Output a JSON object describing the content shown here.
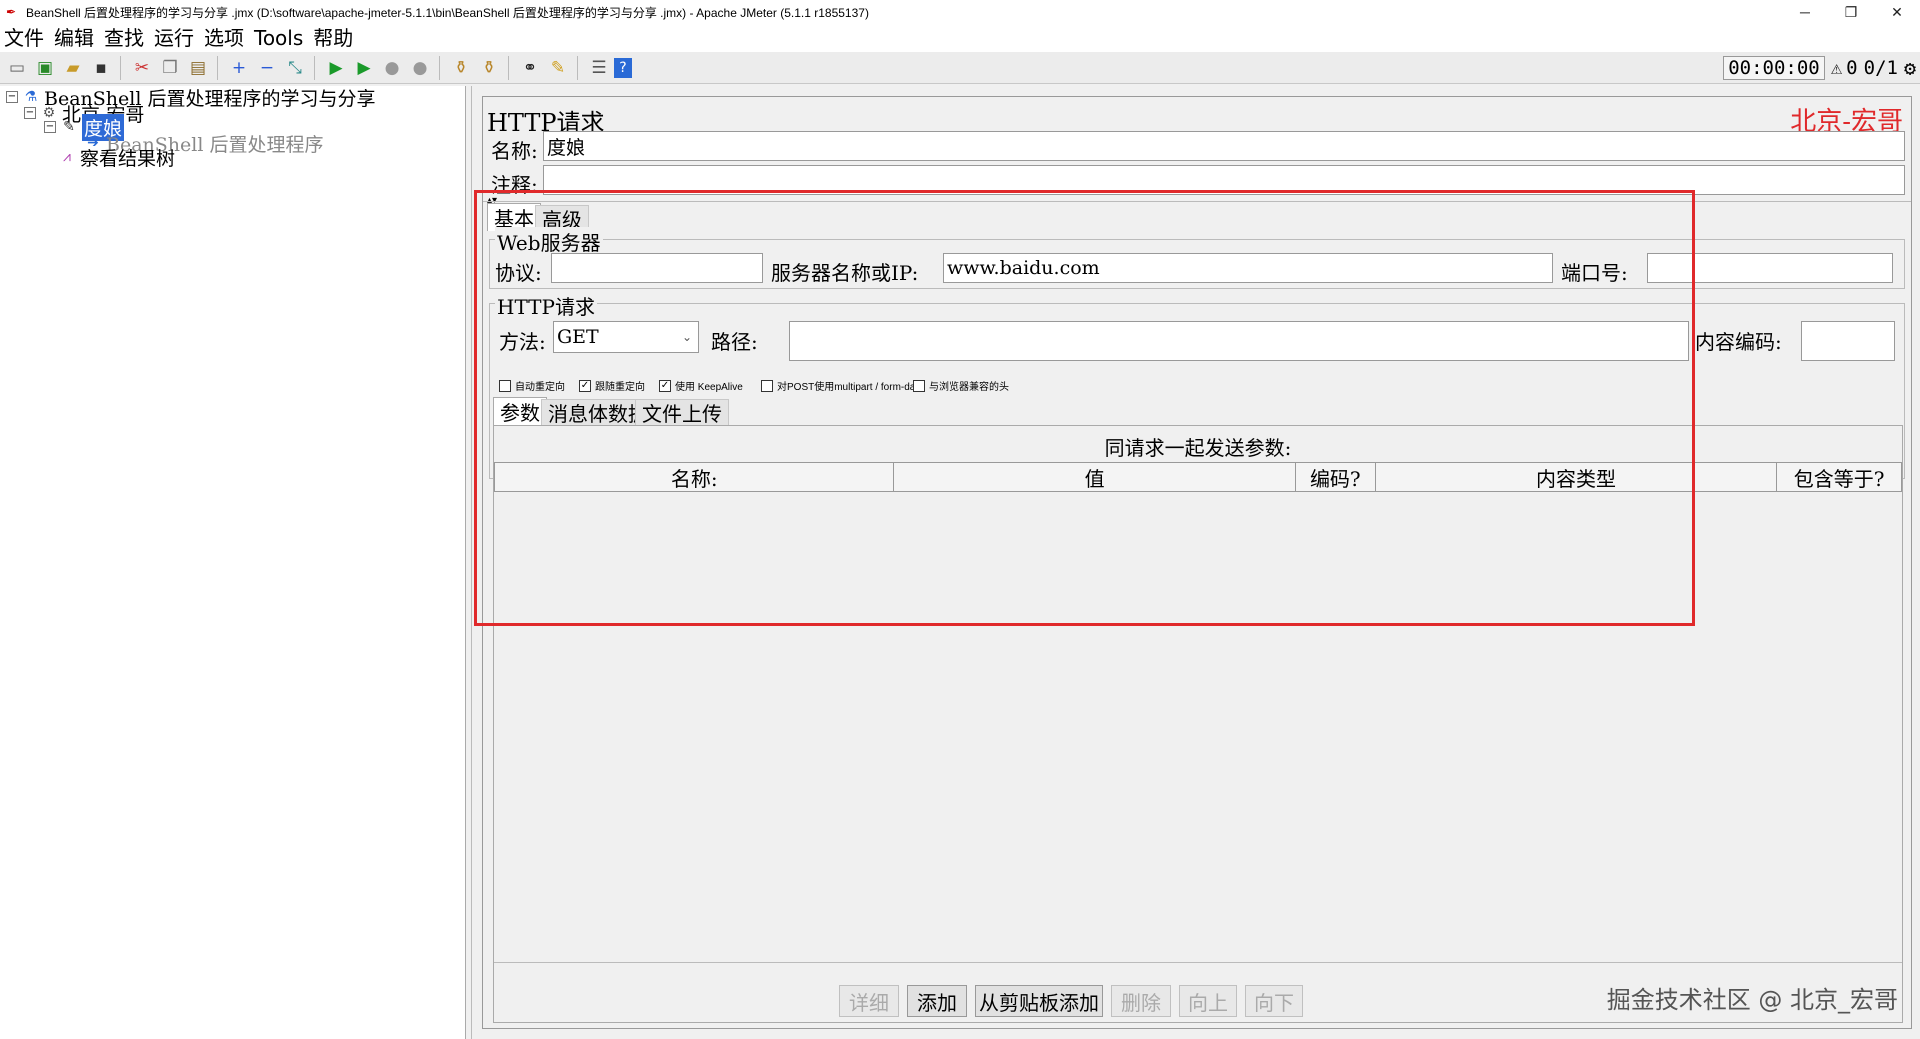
{
  "window": {
    "title": "BeanShell 后置处理程序的学习与分享 .jmx (D:\\software\\apache-jmeter-5.1.1\\bin\\BeanShell 后置处理程序的学习与分享 .jmx) - Apache JMeter (5.1.1 r1855137)",
    "minimize": "─",
    "restore": "❐",
    "close": "✕"
  },
  "menu": [
    "文件",
    "编辑",
    "查找",
    "运行",
    "选项",
    "Tools",
    "帮助"
  ],
  "toolbar": {
    "icons": [
      "new-icon",
      "templates-icon",
      "open-icon",
      "save-icon",
      "cut-icon",
      "copy-icon",
      "paste-icon",
      "expand-icon",
      "collapse-icon",
      "toggle-icon",
      "start-icon",
      "start-no-pause-icon",
      "stop-icon",
      "shutdown-icon",
      "clear-icon",
      "clear-all-icon",
      "search-icon",
      "reset-search-icon",
      "function-helper-icon",
      "help-icon"
    ],
    "timer": "00:00:00",
    "warning_count": "0",
    "threads": "0/1"
  },
  "tree": {
    "root": "BeanShell 后置处理程序的学习与分享",
    "thread_group": "北京-宏哥",
    "sampler": "度娘",
    "post_processor": "BeanShell 后置处理程序",
    "listener": "察看结果树"
  },
  "sampler": {
    "title": "HTTP请求",
    "watermark": "北京-宏哥",
    "name_label": "名称:",
    "name_value": "度娘",
    "comment_label": "注释:",
    "comment_value": "",
    "tabs": [
      "基本",
      "高级"
    ],
    "web_server": {
      "legend": "Web服务器",
      "protocol_label": "协议:",
      "protocol_value": "",
      "server_label": "服务器名称或IP:",
      "server_value": "www.baidu.com",
      "port_label": "端口号:",
      "port_value": ""
    },
    "http_request": {
      "legend": "HTTP请求",
      "method_label": "方法:",
      "method_value": "GET",
      "path_label": "路径:",
      "path_value": "",
      "encoding_label": "内容编码:",
      "encoding_value": ""
    },
    "checkboxes": [
      {
        "label": "自动重定向",
        "checked": false
      },
      {
        "label": "跟随重定向",
        "checked": true
      },
      {
        "label": "使用 KeepAlive",
        "checked": true
      },
      {
        "label": "对POST使用multipart / form-data",
        "checked": false
      },
      {
        "label": "与浏览器兼容的头",
        "checked": false
      }
    ],
    "param_tabs": [
      "参数",
      "消息体数据",
      "文件上传"
    ],
    "params_caption": "同请求一起发送参数:",
    "columns": [
      "名称:",
      "值",
      "编码?",
      "内容类型",
      "包含等于?"
    ],
    "buttons": {
      "detail": "详细",
      "add": "添加",
      "add_clipboard": "从剪贴板添加",
      "delete": "删除",
      "up": "向上",
      "down": "向下"
    }
  },
  "footer_watermark": "掘金技术社区 @ 北京_宏哥"
}
